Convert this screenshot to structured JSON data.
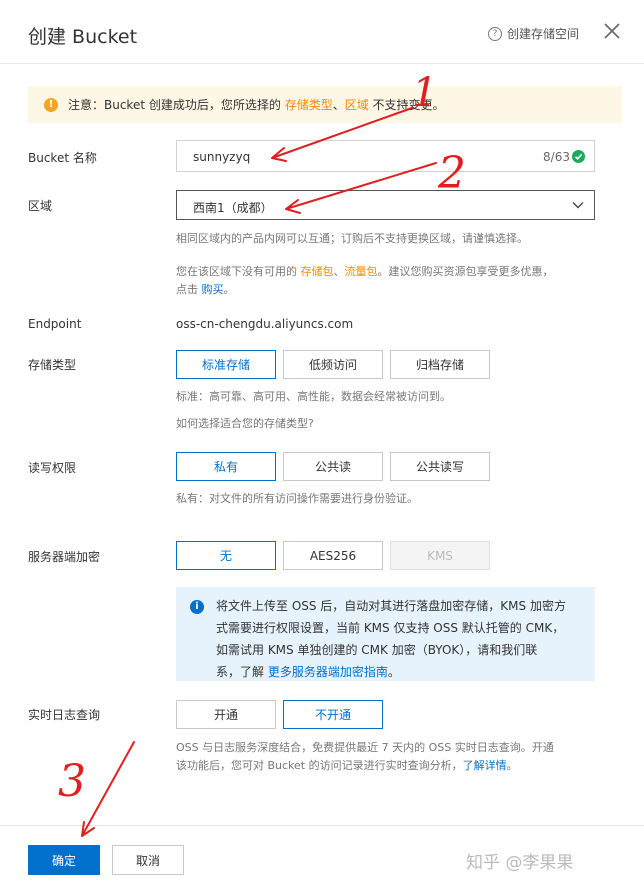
{
  "dialog": {
    "title": "创建 Bucket",
    "help_link": "创建存储空间"
  },
  "notice": {
    "prefix": "注意：Bucket 创建成功后，您所选择的 ",
    "link1": "存储类型",
    "sep": "、",
    "link2": "区域",
    "suffix": " 不支持变更。"
  },
  "bucket_name": {
    "label": "Bucket 名称",
    "value": "sunnyzyq",
    "count": "8/63"
  },
  "region": {
    "label": "区域",
    "value": "西南1（成都）",
    "help1": "相同区域内的产品内网可以互通；订购后不支持更换区域，请谨慎选择。",
    "help2_prefix": "您在该区域下没有可用的 ",
    "help2_link1": "存储包",
    "help2_sep": "、",
    "help2_link2": "流量包",
    "help2_suffix": "。建议您购买资源包享受更多优惠，",
    "help3_prefix": "点击 ",
    "help3_link": "购买",
    "help3_suffix": "。"
  },
  "endpoint": {
    "label": "Endpoint",
    "value": "oss-cn-chengdu.aliyuncs.com"
  },
  "storage_class": {
    "label": "存储类型",
    "options": [
      "标准存储",
      "低频访问",
      "归档存储"
    ],
    "selected": "标准存储",
    "desc": "标准：高可靠、高可用、高性能，数据会经常被访问到。",
    "link": "如何选择适合您的存储类型?"
  },
  "acl": {
    "label": "读写权限",
    "options": [
      "私有",
      "公共读",
      "公共读写"
    ],
    "selected": "私有",
    "desc": "私有：对文件的所有访问操作需要进行身份验证。"
  },
  "encryption": {
    "label": "服务器端加密",
    "options": [
      "无",
      "AES256",
      "KMS"
    ],
    "selected": "无",
    "info_line1": "将文件上传至 OSS 后，自动对其进行落盘加密存储，KMS 加密方",
    "info_line2": "式需要进行权限设置，当前 KMS 仅支持 OSS 默认托管的 CMK，",
    "info_line3": "如需试用 KMS 单独创建的 CMK 加密（BYOK），请和我们联",
    "info_line4_prefix": "系，了解 ",
    "info_link": "更多服务器端加密指南",
    "info_line4_suffix": "。"
  },
  "realtime_log": {
    "label": "实时日志查询",
    "options": [
      "开通",
      "不开通"
    ],
    "selected": "不开通",
    "desc1": "OSS 与日志服务深度结合，免费提供最近 7 天内的 OSS 实时日志查询。开通",
    "desc2_prefix": "该功能后，您可对 Bucket 的访问记录进行实时查询分析，",
    "desc2_link": "了解详情",
    "desc2_suffix": "。"
  },
  "footer": {
    "ok": "确定",
    "cancel": "取消",
    "watermark": "知乎 @李果果"
  },
  "annotations": {
    "num1": "1",
    "num2": "2",
    "num3": "3",
    "color": "#e02020"
  },
  "colors": {
    "accent": "#0070cc",
    "warning": "#f58a00",
    "success": "#1aab5d",
    "notice_bg": "#fff7e5",
    "info_bg": "#e6f3fc"
  }
}
